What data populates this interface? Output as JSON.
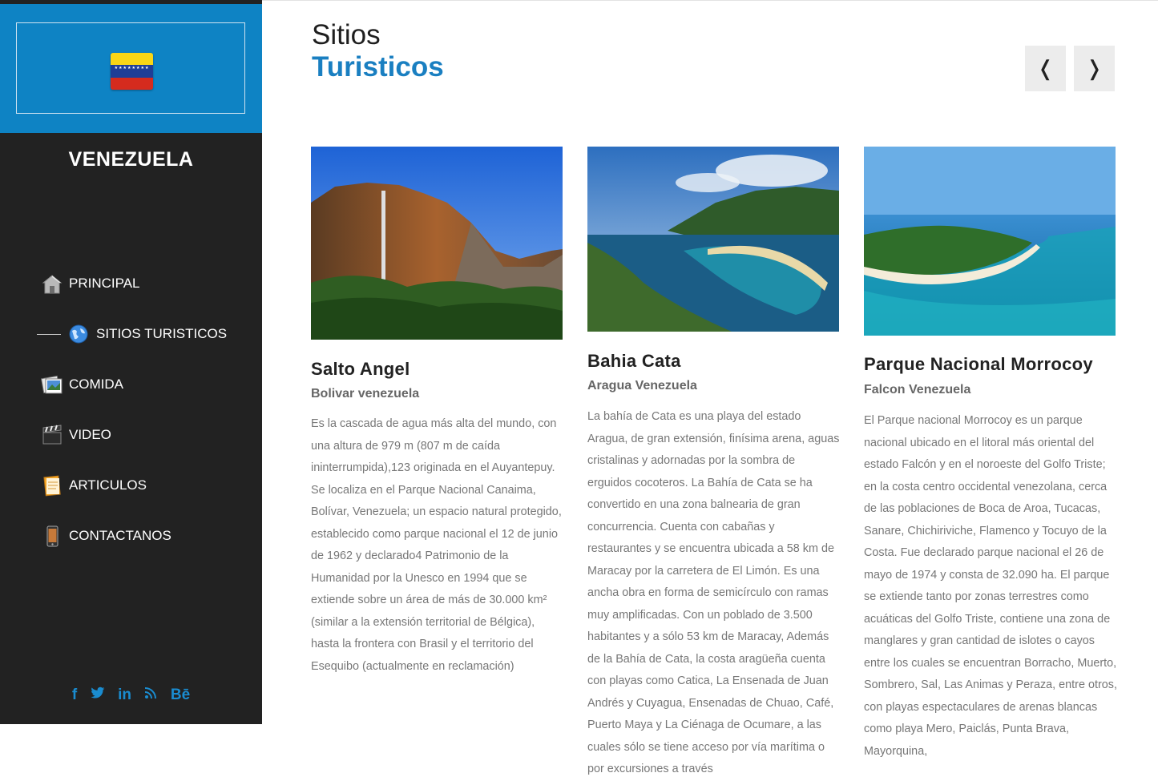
{
  "sidebar": {
    "brand": "VENEZUELA",
    "nav": [
      {
        "label": "PRINCIPAL",
        "icon": "home-icon"
      },
      {
        "label": "SITIOS TURISTICOS",
        "icon": "globe-icon",
        "active": true
      },
      {
        "label": "COMIDA",
        "icon": "photos-icon"
      },
      {
        "label": "VIDEO",
        "icon": "clapperboard-icon"
      },
      {
        "label": "ARTICULOS",
        "icon": "notepad-icon"
      },
      {
        "label": "CONTACTANOS",
        "icon": "phone-icon"
      }
    ],
    "social": [
      "f",
      "t",
      "in",
      "rss",
      "Bē"
    ]
  },
  "header": {
    "title_line1": "Sitios",
    "title_line2": "Turisticos",
    "prev_label": "❬",
    "next_label": "❭"
  },
  "cards": [
    {
      "title": "Salto Angel",
      "subtitle": "Bolivar venezuela",
      "text": "Es la cascada de agua más alta del mundo, con una altura de 979 m (807 m de caída ininterrumpida),123 originada en el Auyantepuy. Se localiza en el Parque Nacional Canaima, Bolívar, Venezuela; un espacio natural protegido, establecido como parque nacional el 12 de junio de 1962 y declarado4 Patrimonio de la Humanidad por la Unesco en 1994 que se extiende sobre un área de más de 30.000 km² (similar a la extensión territorial de Bélgica), hasta la frontera con Brasil y el territorio del Esequibo (actualmente en reclamación)"
    },
    {
      "title": "Bahia Cata",
      "subtitle": "Aragua Venezuela",
      "text": "La bahía de Cata es una playa del estado Aragua, de gran extensión, finísima arena, aguas cristalinas y adornadas por la sombra de erguidos cocoteros. La Bahía de Cata se ha convertido en una zona balnearia de gran concurrencia. Cuenta con cabañas y restaurantes y se encuentra ubicada a 58 km de Maracay por la carretera de El Limón. Es una ancha obra en forma de semicírculo con ramas muy amplificadas. Con un poblado de 3.500 habitantes y a sólo 53 km de Maracay, Además de la Bahía de Cata, la costa aragüeña cuenta con playas como Catica, La Ensenada de Juan Andrés y Cuyagua, Ensenadas de Chuao, Café, Puerto Maya y La Ciénaga de Ocumare, a las cuales sólo se tiene acceso por vía marítima o por excursiones a través"
    },
    {
      "title": "Parque Nacional Morrocoy",
      "subtitle": "Falcon Venezuela",
      "text": "El Parque nacional Morrocoy es un parque nacional ubicado en el litoral más oriental del estado Falcón y en el noroeste del Golfo Triste; en la costa centro occidental venezolana, cerca de las poblaciones de Boca de Aroa, Tucacas, Sanare, Chichiriviche, Flamenco y Tocuyo de la Costa. Fue declarado parque nacional el 26 de mayo de 1974 y consta de 32.090 ha. El parque se extiende tanto por zonas terrestres como acuáticas del Golfo Triste, contiene una zona de manglares y gran cantidad de islotes o cayos entre los cuales se encuentran Borracho, Muerto, Sombrero, Sal, Las Animas y Peraza, entre otros, con playas espectaculares de arenas blancas como playa Mero, Paiclás, Punta Brava, Mayorquina,"
    }
  ],
  "colors": {
    "sidebar_bg": "#222222",
    "brand_blue": "#0e83c4",
    "title_blue": "#1a7fc1"
  }
}
